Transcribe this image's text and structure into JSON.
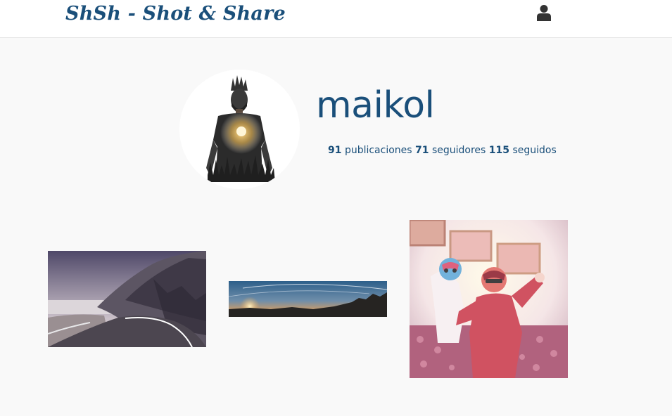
{
  "navbar": {
    "brand": "ShSh - Shot & Share",
    "user_icon": "user-icon"
  },
  "profile": {
    "username": "maikol",
    "avatar": "avatar",
    "stats": {
      "posts_count": "91",
      "posts_label": "publicaciones",
      "followers_count": "71",
      "followers_label": "seguidores",
      "following_count": "115",
      "following_label": "seguidos"
    }
  },
  "photos": [
    {
      "id": "photo-1",
      "subject": "mountain road"
    },
    {
      "id": "photo-2",
      "subject": "sunset panorama"
    },
    {
      "id": "photo-3",
      "subject": "two people in masks"
    }
  ],
  "colors": {
    "brand": "#1a4f7a",
    "background": "#f9f9f9",
    "navbar": "#ffffff"
  }
}
